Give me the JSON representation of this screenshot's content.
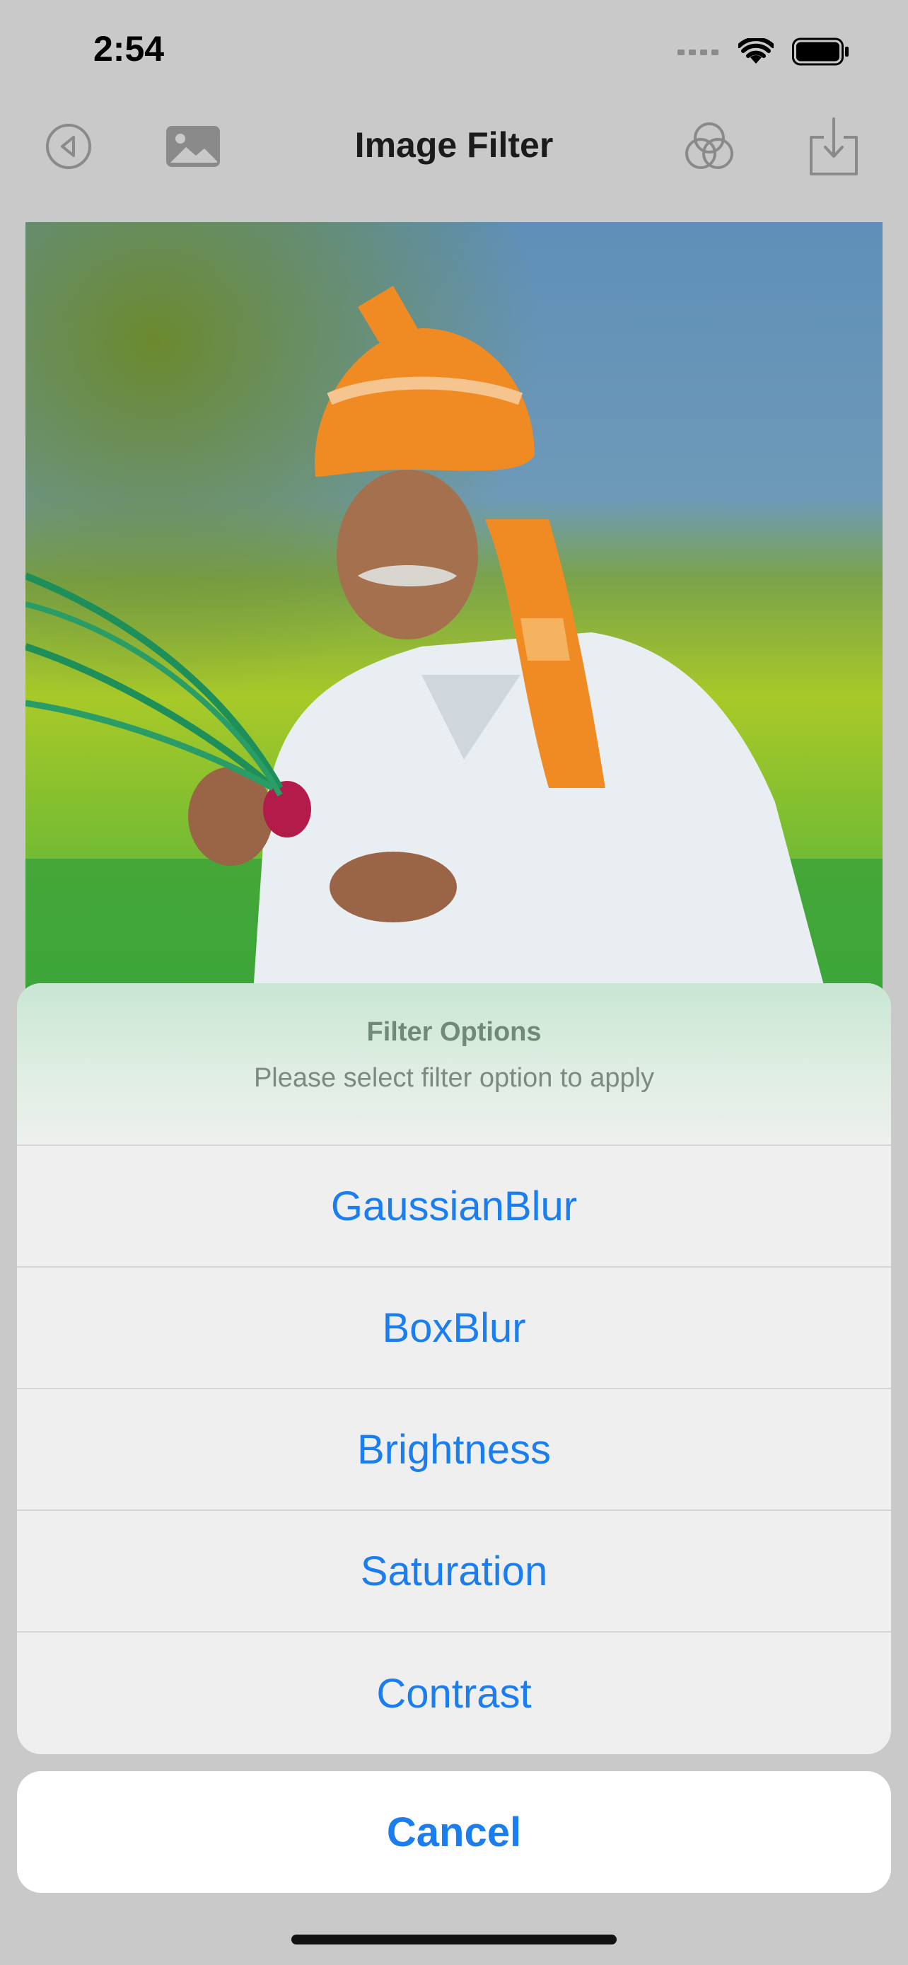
{
  "status_bar": {
    "time": "2:54",
    "icons": [
      "signal-icon",
      "wifi-icon",
      "battery-icon"
    ]
  },
  "nav_bar": {
    "title": "Image Filter",
    "left_icons": [
      "back-icon",
      "photo-library-icon"
    ],
    "right_icons": [
      "filters-icon",
      "save-icon"
    ]
  },
  "photo": {
    "description_icon": "photo-preview"
  },
  "action_sheet": {
    "title": "Filter Options",
    "message": "Please select filter option to apply",
    "options": [
      "GaussianBlur",
      "BoxBlur",
      "Brightness",
      "Saturation",
      "Contrast"
    ],
    "cancel_label": "Cancel"
  },
  "colors": {
    "accent": "#1a7ef0",
    "dim_background": "#c9c9c9",
    "sheet_background": "#efefef"
  }
}
